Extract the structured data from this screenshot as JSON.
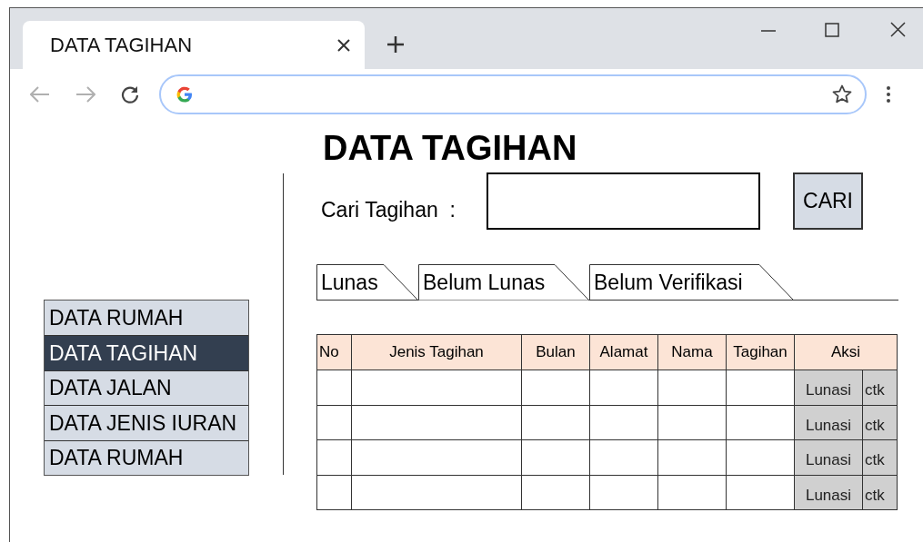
{
  "browser": {
    "tab_title": "DATA TAGIHAN"
  },
  "sidebar": {
    "items": [
      {
        "label": "DATA RUMAH",
        "selected": false
      },
      {
        "label": "DATA TAGIHAN",
        "selected": true
      },
      {
        "label": "DATA JALAN",
        "selected": false
      },
      {
        "label": "DATA JENIS IURAN",
        "selected": false
      },
      {
        "label": "DATA RUMAH",
        "selected": false
      }
    ]
  },
  "heading": "DATA TAGIHAN",
  "search": {
    "label": "Cari Tagihan  :",
    "button": "CARI"
  },
  "tabs": [
    {
      "label": "Lunas",
      "selected": false
    },
    {
      "label": "Belum Lunas",
      "selected": true
    },
    {
      "label": "Belum Verifikasi",
      "selected": false
    }
  ],
  "table": {
    "columns": [
      "No",
      "Jenis Tagihan",
      "Bulan",
      "Alamat",
      "Nama",
      "Tagihan",
      "Aksi"
    ],
    "rows": [
      {
        "actions": [
          "Lunasi",
          "ctk"
        ]
      },
      {
        "actions": [
          "Lunasi",
          "ctk"
        ]
      },
      {
        "actions": [
          "Lunasi",
          "ctk"
        ]
      },
      {
        "actions": [
          "Lunasi",
          "ctk"
        ]
      }
    ]
  }
}
